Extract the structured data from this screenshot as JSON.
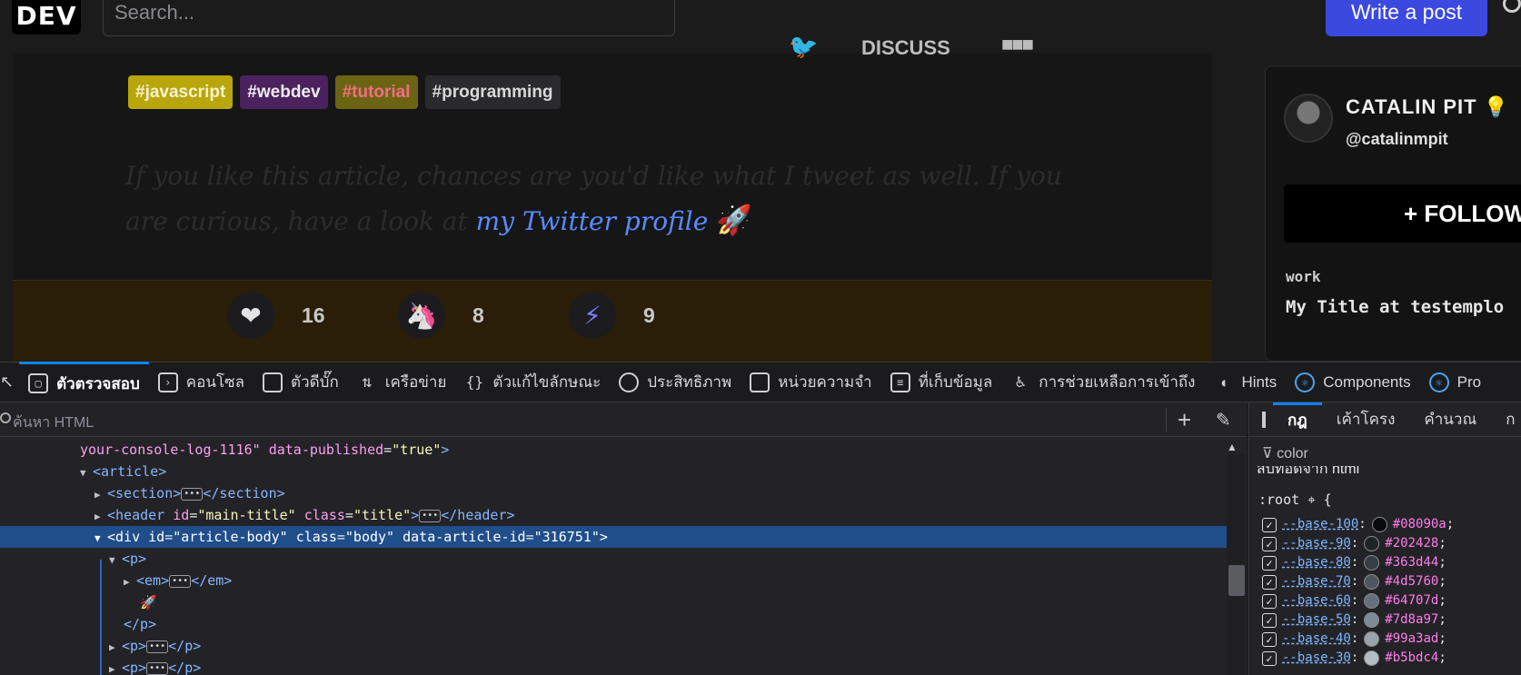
{
  "site": {
    "logo": "DEV",
    "search_placeholder": "Search...",
    "write_post": "Write a post"
  },
  "article": {
    "tags": [
      "#javascript",
      "#webdev",
      "#tutorial",
      "#programming"
    ],
    "quote_text": "If you like this article, chances are you'd like what I tweet as well. If you are curious, have a look at",
    "quote_link": "my Twitter profile",
    "quote_emoji": "🚀",
    "reactions": {
      "heart": "16",
      "unicorn": "8",
      "save": "9",
      "discuss": "DISCUSS"
    }
  },
  "profile": {
    "name": "CATALIN PIT 💡",
    "handle": "@catalinmpit",
    "follow": "+ FOLLOW",
    "work_label": "work",
    "work_value": "My Title at testemplo"
  },
  "devtools": {
    "tabs": [
      "ตัวตรวจสอบ",
      "คอนโซล",
      "ตัวดีบั๊ก",
      "เครือข่าย",
      "ตัวแก้ไขลักษณะ",
      "ประสิทธิภาพ",
      "หน่วยความจำ",
      "ที่เก็บข้อมูล",
      "การช่วยเหลือการเข้าถึง",
      "Hints",
      "Components",
      "Pro"
    ],
    "html_search_placeholder": "ค้นหา HTML",
    "rules_tabs": [
      "กฎ",
      "เค้าโครง",
      "คำนวณ",
      "ก"
    ],
    "filter_text": "color",
    "inherited_text": "สืบทอดจาก html",
    "root_selector": ":root",
    "tree": {
      "r0_attrval": "your-console-log-1116\"",
      "r0_attr": "data-published",
      "r0_val": "\"true\"",
      "article": "<article>",
      "section_open": "<section>",
      "section_close": "</section>",
      "header_tag": "<header",
      "header_id_attr": "id",
      "header_id_val": "\"main-title\"",
      "header_class_attr": "class",
      "header_class_val": "\"title\"",
      "header_close": "</header>",
      "div_tag": "<div",
      "div_id_attr": "id",
      "div_id_val": "\"article-body\"",
      "div_class_attr": "class",
      "div_class_val": "\"body\"",
      "div_data_attr": "data-article-id",
      "div_data_val": "\"316751\"",
      "p_open": "<p>",
      "em_open": "<em>",
      "em_close": "</em>",
      "rocket": "🚀",
      "p_close": "</p>"
    },
    "css_vars": [
      {
        "name": "--base-100",
        "value": "#08090a"
      },
      {
        "name": "--base-90",
        "value": "#202428"
      },
      {
        "name": "--base-80",
        "value": "#363d44"
      },
      {
        "name": "--base-70",
        "value": "#4d5760"
      },
      {
        "name": "--base-60",
        "value": "#64707d"
      },
      {
        "name": "--base-50",
        "value": "#7d8a97"
      },
      {
        "name": "--base-40",
        "value": "#99a3ad"
      },
      {
        "name": "--base-30",
        "value": "#b5bdc4"
      }
    ]
  }
}
